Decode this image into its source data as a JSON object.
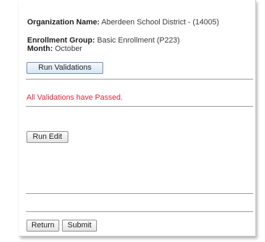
{
  "header": {
    "organization_label": "Organization Name:",
    "organization_value": "Aberdeen School District - (14005)",
    "enrollment_label": "Enrollment Group:",
    "enrollment_value": "Basic Enrollment (P223)",
    "month_label": "Month:",
    "month_value": "October"
  },
  "actions": {
    "run_validations_label": "Run Validations",
    "validation_message": "All Validations have Passed.",
    "run_edit_label": "Run Edit"
  },
  "footer": {
    "return_label": "Return",
    "submit_label": "Submit"
  },
  "colors": {
    "success_message": "#e0243a"
  }
}
